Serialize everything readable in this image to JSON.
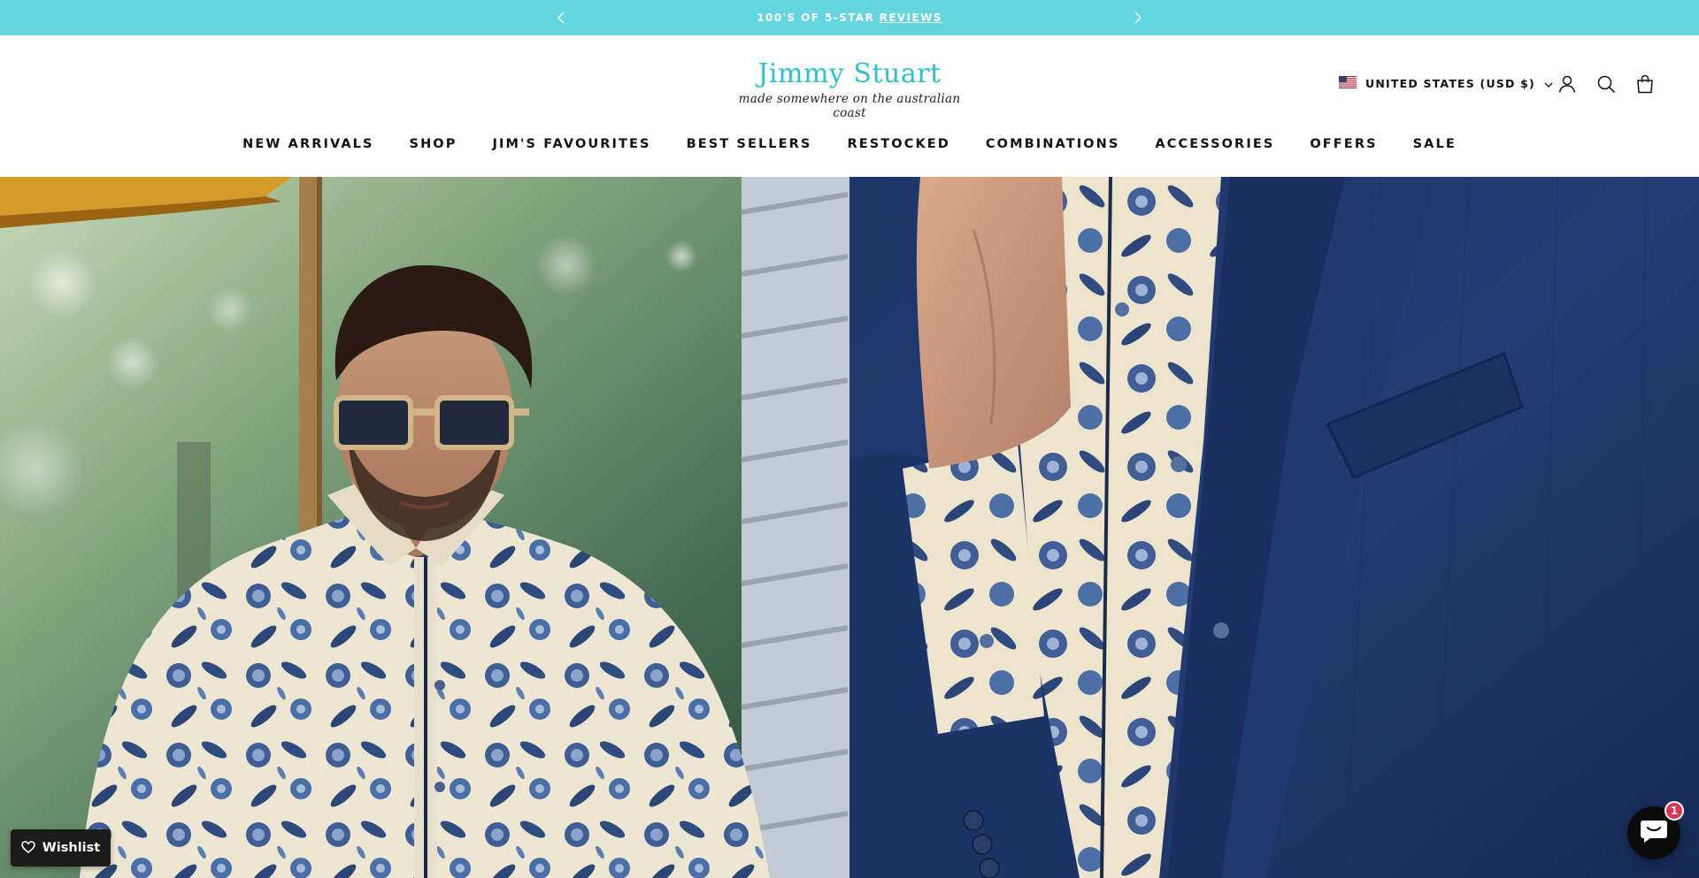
{
  "announcement": {
    "text": "100'S OF 5-STAR",
    "link": "REVIEWS",
    "background": "#63d5df",
    "prev_icon": "chevron-left-icon",
    "next_icon": "chevron-right-icon"
  },
  "brand": {
    "name": "Jimmy Stuart",
    "tagline": "made somewhere on the australian coast",
    "color": "#2fc0c8"
  },
  "header": {
    "locale": "UNITED STATES (USD $)",
    "locale_flag": "us-flag-icon",
    "icons": [
      "account-icon",
      "search-icon",
      "cart-icon"
    ]
  },
  "nav": {
    "items": [
      "NEW ARRIVALS",
      "SHOP",
      "JIM'S FAVOURITES",
      "BEST SELLERS",
      "RESTOCKED",
      "COMBINATIONS",
      "ACCESSORIES",
      "OFFERS",
      "SALE"
    ]
  },
  "hero": {
    "left_image": "man-in-floral-shirt-sunglasses",
    "right_image": "floral-shirt-navy-blazer-closeup"
  },
  "wishlist": {
    "label": "Wishlist",
    "icon": "heart-icon"
  },
  "chat": {
    "icon": "chat-icon",
    "badge": "1",
    "badge_color": "#e03355"
  }
}
